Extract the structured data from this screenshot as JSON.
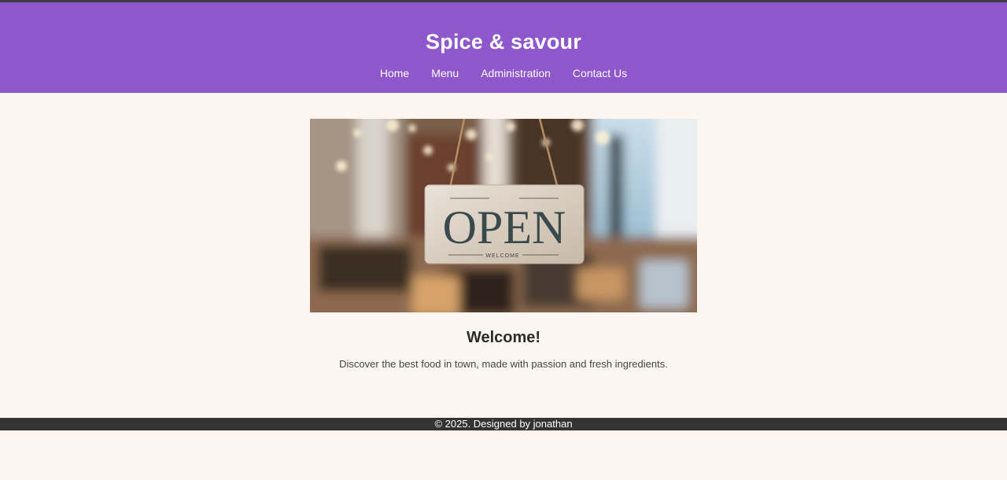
{
  "header": {
    "title": "Spice & savour",
    "nav": [
      {
        "label": "Home"
      },
      {
        "label": "Menu"
      },
      {
        "label": "Administration"
      },
      {
        "label": "Contact Us"
      }
    ]
  },
  "hero": {
    "sign_text": "OPEN",
    "sign_subtext": "WELCOME"
  },
  "main": {
    "heading": "Welcome!",
    "description": "Discover the best food in town, made with passion and fresh ingredients."
  },
  "footer": {
    "text": "© 2025. Designed by jonathan"
  },
  "colors": {
    "header_bg": "#8e57cc",
    "page_bg": "#fdf5ef",
    "footer_bg": "#333333"
  }
}
